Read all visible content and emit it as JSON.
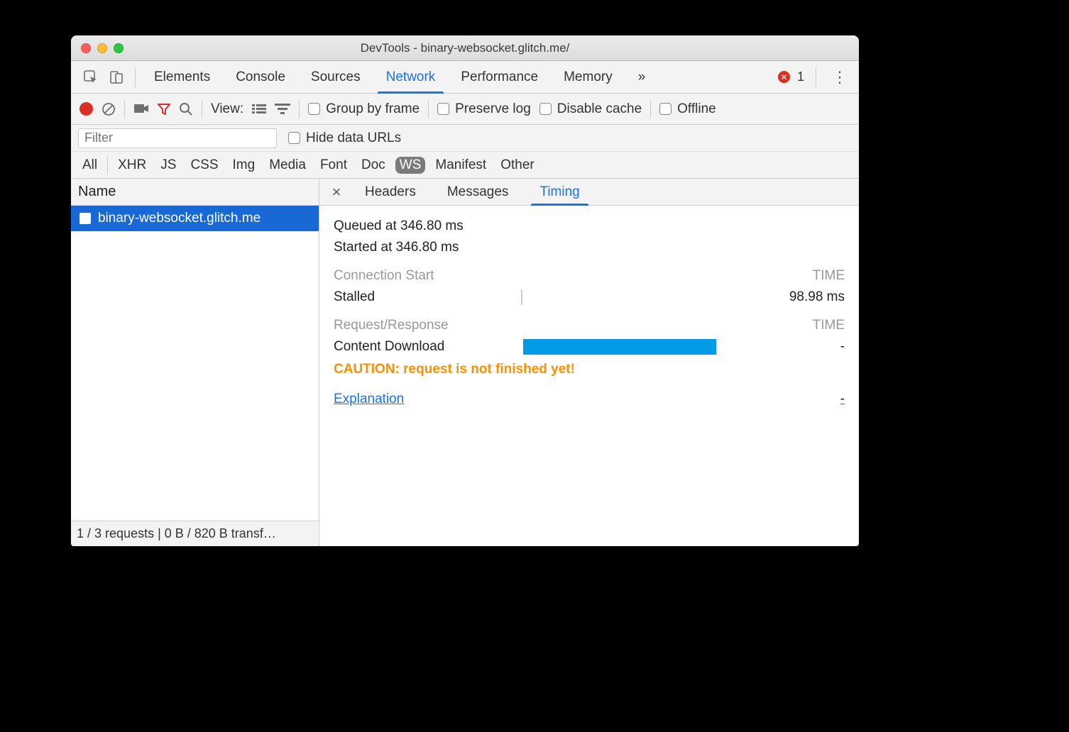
{
  "window": {
    "title": "DevTools - binary-websocket.glitch.me/"
  },
  "mainTabs": {
    "items": [
      "Elements",
      "Console",
      "Sources",
      "Network",
      "Performance",
      "Memory"
    ],
    "more": "»",
    "active": "Network"
  },
  "errors": {
    "count": "1"
  },
  "netbar": {
    "viewLabel": "View:",
    "groupByFrame": "Group by frame",
    "preserveLog": "Preserve log",
    "disableCache": "Disable cache",
    "offline": "Offline"
  },
  "filterbar": {
    "placeholder": "Filter",
    "hideDataUrls": "Hide data URLs"
  },
  "typeFilters": {
    "items": [
      "All",
      "XHR",
      "JS",
      "CSS",
      "Img",
      "Media",
      "Font",
      "Doc",
      "WS",
      "Manifest",
      "Other"
    ],
    "active": "WS"
  },
  "sidebar": {
    "header": "Name",
    "rows": [
      {
        "name": "binary-websocket.glitch.me"
      }
    ],
    "footer": "1 / 3 requests | 0 B / 820 B transf…"
  },
  "detail": {
    "tabs": [
      "Headers",
      "Messages",
      "Timing"
    ],
    "active": "Timing",
    "queued": "Queued at 346.80 ms",
    "started": "Started at 346.80 ms",
    "sections": {
      "conn": {
        "title": "Connection Start",
        "timeLabel": "TIME"
      },
      "stalled": {
        "label": "Stalled",
        "value": "98.98 ms"
      },
      "reqres": {
        "title": "Request/Response",
        "timeLabel": "TIME"
      },
      "content": {
        "label": "Content Download",
        "value": "-"
      }
    },
    "caution": "CAUTION: request is not finished yet!",
    "explanation": "Explanation",
    "explanationDash": "-"
  }
}
